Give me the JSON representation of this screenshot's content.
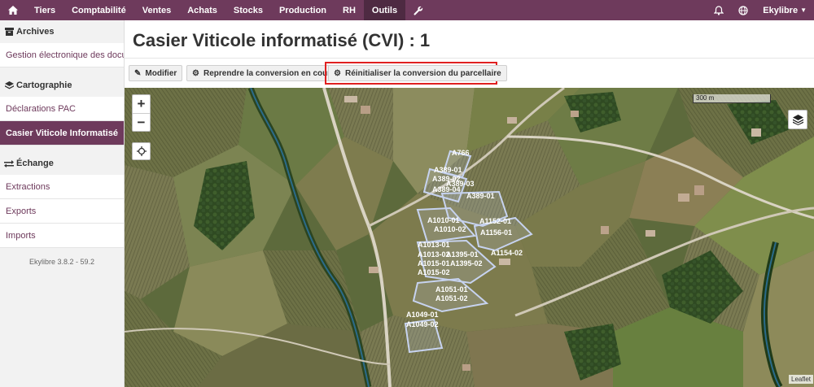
{
  "navbar": {
    "home_icon": "home-icon",
    "items": [
      "Tiers",
      "Comptabilité",
      "Ventes",
      "Achats",
      "Stocks",
      "Production",
      "RH",
      "Outils"
    ],
    "active": "Outils",
    "tools_icon": "wrench-icon",
    "bell_icon": "bell-icon",
    "globe_icon": "globe-icon",
    "account": "Ekylibre"
  },
  "sidebar": {
    "sections": [
      {
        "title": "Archives",
        "icon": "archive-icon",
        "items": [
          {
            "label": "Gestion électronique des docu…"
          }
        ]
      },
      {
        "title": "Cartographie",
        "icon": "layers-icon",
        "items": [
          {
            "label": "Déclarations PAC"
          },
          {
            "label": "Casier Viticole Informatisé"
          }
        ]
      },
      {
        "title": "Échange",
        "icon": "exchange-icon",
        "items": [
          {
            "label": "Extractions"
          },
          {
            "label": "Exports"
          },
          {
            "label": "Imports"
          }
        ]
      }
    ],
    "active_item": "Casier Viticole Informatisé",
    "version": "Ekylibre 3.8.2 - 59.2"
  },
  "page": {
    "title": "Casier Viticole informatisé (CVI) : 1"
  },
  "toolbar": {
    "modify_label": "Modifier",
    "resume_label": "Reprendre la conversion en cours",
    "reset_label": "Réinitialiser la conversion du parcellaire",
    "modify_icon": "pencil-icon",
    "resume_icon": "gear-icon",
    "reset_icon": "gear-icon"
  },
  "map": {
    "zoom_in": "+",
    "zoom_out": "−",
    "scale_label": "300 m",
    "attribution": "Leaflet",
    "parcel_color": "#c7d3f0",
    "parcel_labels": [
      "A766",
      "A389-01",
      "A389-02",
      "A389-03",
      "A389-04",
      "A1010-01",
      "A1010-02",
      "A1013-01",
      "A1013-02",
      "A1015-01",
      "A1015-02",
      "A1395-01",
      "A1395-02",
      "A1051-01",
      "A1051-02",
      "A1049-01",
      "A1049-02",
      "A1154-02",
      "A1156-01",
      "A1152-01",
      "A389-01"
    ]
  }
}
